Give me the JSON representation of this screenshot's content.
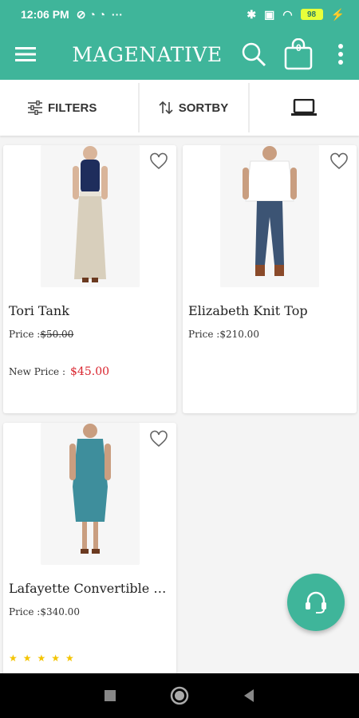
{
  "status_bar": {
    "time": "12:06 PM",
    "battery": "98"
  },
  "app_bar": {
    "title": "MAGENATIVE",
    "cart_count": "0"
  },
  "toolbar": {
    "filters_label": "FILTERS",
    "sort_label": "SORTBY"
  },
  "products": [
    {
      "name": "Tori Tank",
      "price_label": "Price :",
      "price": "$50.00",
      "new_price_label": "New Price :",
      "new_price": "$45.00"
    },
    {
      "name": "Elizabeth Knit Top",
      "price_label": "Price :",
      "price": "$210.00"
    },
    {
      "name": "Lafayette Convertible D...",
      "price_label": "Price :",
      "price": "$340.00",
      "rating": "★★★★★"
    }
  ],
  "colors": {
    "primary": "#3fb59a",
    "sale_red": "#d9232d"
  },
  "icons": {
    "menu": "menu-icon",
    "search": "search-icon",
    "cart": "shopping-bag-icon",
    "more": "more-vertical-icon",
    "filters": "sliders-icon",
    "sort": "sort-icon",
    "view": "laptop-icon",
    "wishlist": "heart-icon",
    "support": "headset-icon"
  }
}
